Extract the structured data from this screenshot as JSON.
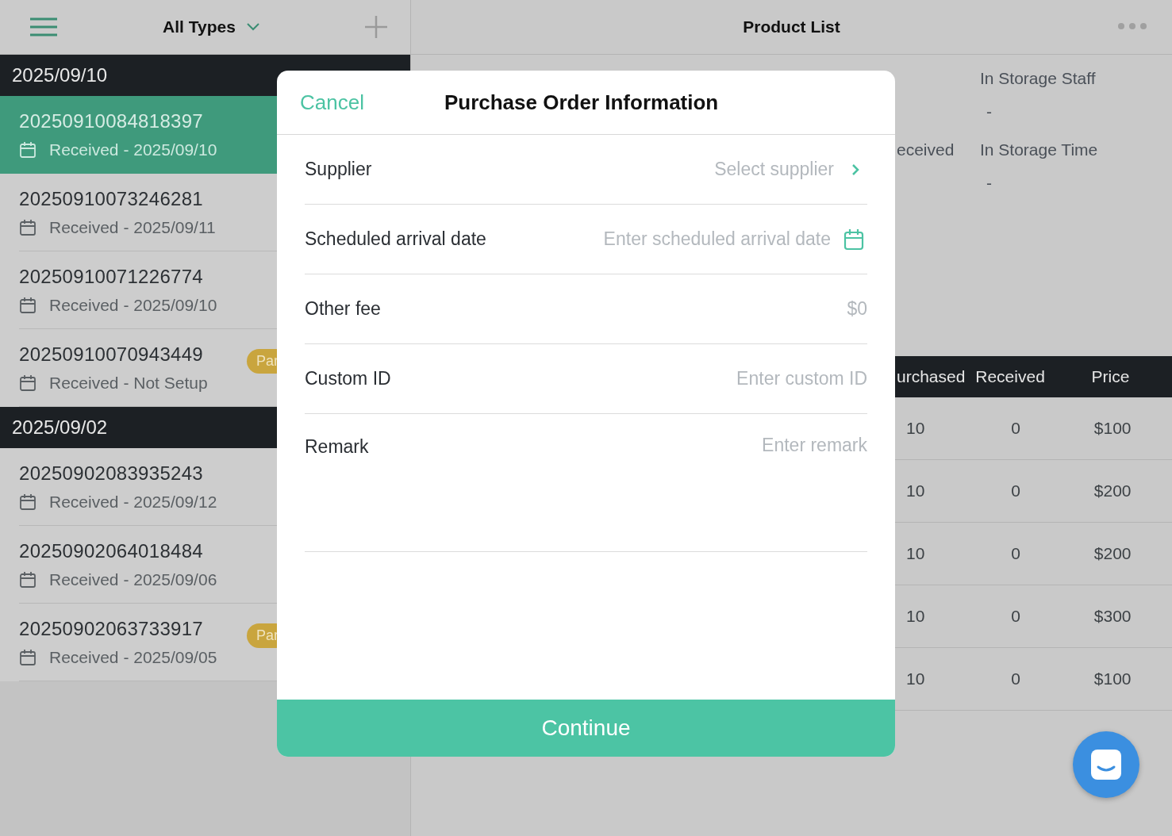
{
  "header": {
    "filter": "All Types",
    "title": "Product List"
  },
  "groups": [
    {
      "date": "2025/09/10",
      "orders": [
        {
          "id": "20250910084818397",
          "status": "Received - 2025/09/10",
          "selected": true
        },
        {
          "id": "20250910073246281",
          "status": "Received - 2025/09/11",
          "selected": false
        },
        {
          "id": "20250910071226774",
          "status": "Received - 2025/09/10",
          "selected": false
        },
        {
          "id": "20250910070943449",
          "status": "Received - Not Setup",
          "selected": false,
          "badge": "Par"
        }
      ]
    },
    {
      "date": "2025/09/02",
      "orders": [
        {
          "id": "20250902083935243",
          "status": "Received - 2025/09/12",
          "selected": false
        },
        {
          "id": "20250902064018484",
          "status": "Received - 2025/09/06",
          "selected": false
        },
        {
          "id": "20250902063733917",
          "status": "Received - 2025/09/05",
          "selected": false,
          "badge": "Par"
        }
      ]
    }
  ],
  "details": [
    {
      "right": {
        "label": "In Storage Staff",
        "value": "-"
      }
    },
    {
      "left": "eceived",
      "right": {
        "label": "In Storage Time",
        "value": "-"
      }
    }
  ],
  "table": {
    "columns": [
      "urchased",
      "Received",
      "Price"
    ],
    "rows": [
      [
        "10",
        "0",
        "$100"
      ],
      [
        "10",
        "0",
        "$200"
      ],
      [
        "10",
        "0",
        "$200"
      ],
      [
        "10",
        "0",
        "$300"
      ],
      [
        "10",
        "0",
        "$100"
      ]
    ]
  },
  "modal": {
    "cancel": "Cancel",
    "title": "Purchase Order Information",
    "fields": [
      {
        "kind": "select",
        "label": "Supplier",
        "placeholder": "Select supplier"
      },
      {
        "kind": "date",
        "label": "Scheduled arrival date",
        "placeholder": "Enter scheduled arrival date"
      },
      {
        "kind": "text",
        "label": "Other fee",
        "placeholder": "$0"
      },
      {
        "kind": "text",
        "label": "Custom ID",
        "placeholder": "Enter custom ID"
      },
      {
        "kind": "textarea",
        "label": "Remark",
        "placeholder": "Enter remark"
      }
    ],
    "button": "Continue"
  }
}
